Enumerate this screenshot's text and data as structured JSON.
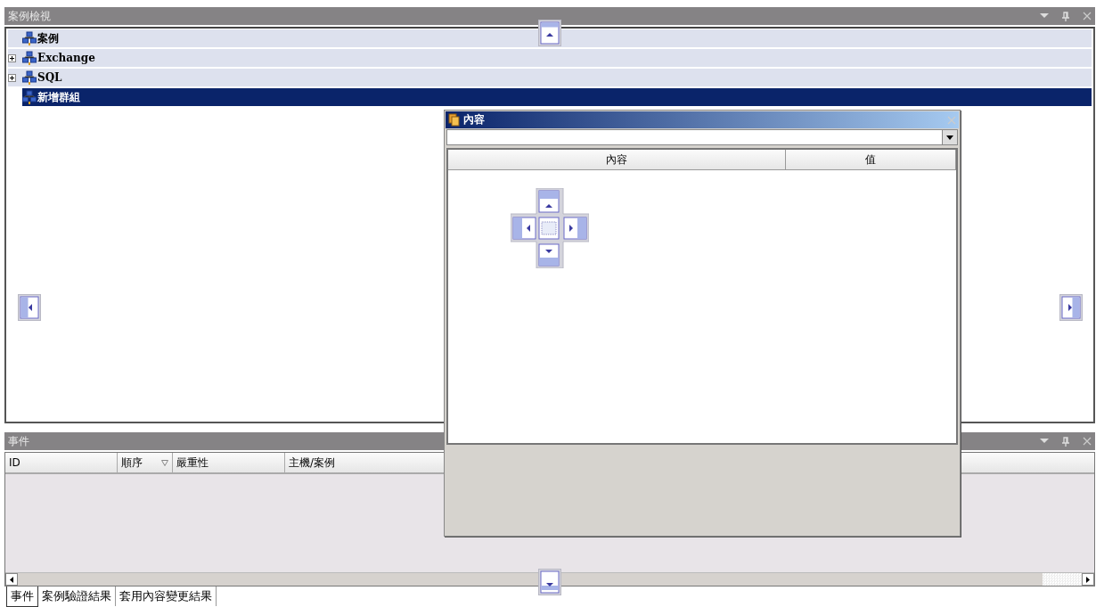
{
  "top_panel": {
    "title": "案例檢視",
    "tree": [
      {
        "label": "案例",
        "expandable": false,
        "selected": false
      },
      {
        "label": "Exchange",
        "expandable": true,
        "selected": false
      },
      {
        "label": "SQL",
        "expandable": true,
        "selected": false
      },
      {
        "label": "新增群組",
        "expandable": false,
        "selected": true
      }
    ]
  },
  "events_panel": {
    "title": "事件",
    "columns": [
      {
        "label": "ID",
        "sorted": false
      },
      {
        "label": "順序",
        "sorted": true
      },
      {
        "label": "嚴重性",
        "sorted": false
      },
      {
        "label": "主機/案例",
        "sorted": false
      }
    ]
  },
  "bottom_tabs": [
    {
      "label": "事件",
      "selected": true
    },
    {
      "label": "案例驗證結果",
      "selected": false
    },
    {
      "label": "套用內容變更結果",
      "selected": false
    }
  ],
  "properties_window": {
    "title": "內容",
    "columns": [
      "內容",
      "值"
    ]
  }
}
